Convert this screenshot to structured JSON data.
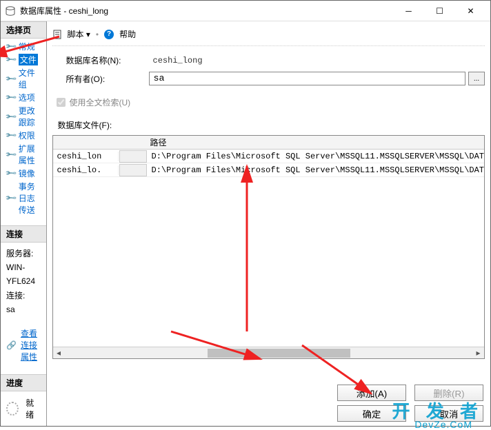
{
  "window": {
    "title": "数据库属性 - ceshi_long"
  },
  "sidebar": {
    "selectPageHeader": "选择页",
    "pages": [
      {
        "label": "常规"
      },
      {
        "label": "文件"
      },
      {
        "label": "文件组"
      },
      {
        "label": "选项"
      },
      {
        "label": "更改跟踪"
      },
      {
        "label": "权限"
      },
      {
        "label": "扩展属性"
      },
      {
        "label": "镜像"
      },
      {
        "label": "事务日志传送"
      }
    ],
    "connectionHeader": "连接",
    "serverLabel": "服务器:",
    "serverValue": "WIN-YFL624",
    "connLabel": "连接:",
    "connValue": "sa",
    "viewConnProps": "查看连接属性",
    "progressHeader": "进度",
    "progressStatus": "就绪"
  },
  "toolbar": {
    "script": "脚本",
    "help": "帮助"
  },
  "form": {
    "dbNameLabel": "数据库名称(N):",
    "dbNameValue": "ceshi_long",
    "ownerLabel": "所有者(O):",
    "ownerValue": "sa",
    "ftsLabel": "使用全文检索(U)",
    "filesLabel": "数据库文件(F):",
    "browseBtn": "..."
  },
  "grid": {
    "colName": "",
    "colPath": "路径",
    "rows": [
      {
        "name": "ceshi_lon",
        "path": "D:\\Program Files\\Microsoft SQL Server\\MSSQL11.MSSQLSERVER\\MSSQL\\DAT"
      },
      {
        "name": "ceshi_lo.",
        "path": "D:\\Program Files\\Microsoft SQL Server\\MSSQL11.MSSQLSERVER\\MSSQL\\DAT"
      }
    ]
  },
  "buttons": {
    "add": "添加(A)",
    "remove": "删除(R)",
    "ok": "确定",
    "cancel": "取消"
  },
  "watermark": {
    "main": "开 发 者",
    "sub": "DevZe.CoM"
  }
}
